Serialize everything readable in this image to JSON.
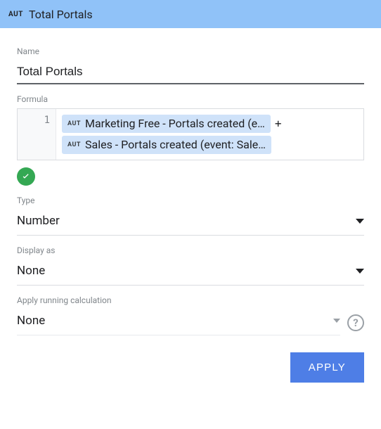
{
  "header": {
    "badge": "AUT",
    "title": "Total Portals"
  },
  "name": {
    "label": "Name",
    "value": "Total Portals"
  },
  "formula": {
    "label": "Formula",
    "line_number": "1",
    "tokens": [
      {
        "badge": "AUT",
        "text": "Marketing Free - Portals created (e…"
      },
      {
        "badge": "AUT",
        "text": "Sales - Portals created (event: Sale…"
      }
    ],
    "operator": "+",
    "valid": true
  },
  "type": {
    "label": "Type",
    "value": "Number"
  },
  "display_as": {
    "label": "Display as",
    "value": "None"
  },
  "running": {
    "label": "Apply running calculation",
    "value": "None"
  },
  "footer": {
    "apply_label": "APPLY"
  }
}
